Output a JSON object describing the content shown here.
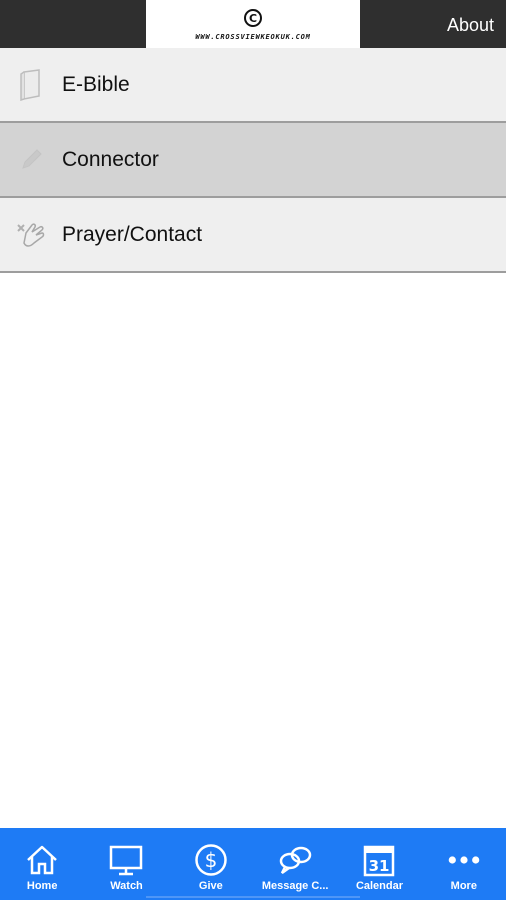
{
  "header": {
    "logo_mark": "C",
    "logo_text": "WWW.CROSSVIEWKEOKUK.COM",
    "about_label": "About"
  },
  "menu": {
    "items": [
      {
        "label": "E-Bible",
        "icon": "bible-icon",
        "selected": false
      },
      {
        "label": "Connector",
        "icon": "pencil-icon",
        "selected": true
      },
      {
        "label": "Prayer/Contact",
        "icon": "praying-hands-icon",
        "selected": false
      }
    ]
  },
  "tabbar": {
    "tabs": [
      {
        "label": "Home",
        "icon": "home-icon"
      },
      {
        "label": "Watch",
        "icon": "monitor-icon"
      },
      {
        "label": "Give",
        "icon": "dollar-icon"
      },
      {
        "label": "Message C...",
        "icon": "chat-bubbles-icon"
      },
      {
        "label": "Calendar",
        "icon": "calendar-icon",
        "calendar_day": "31"
      },
      {
        "label": "More",
        "icon": "more-dots-icon"
      }
    ]
  },
  "colors": {
    "header_bg": "#2f2f2f",
    "tabbar_bg": "#1e7bf5",
    "menu_bg": "#efefef",
    "menu_selected_bg": "#d3d3d3"
  }
}
